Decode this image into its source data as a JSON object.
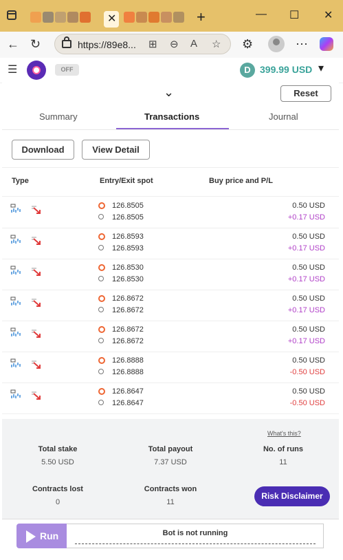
{
  "browser": {
    "url": "https://89e8...",
    "new_tab": "+"
  },
  "app": {
    "toggle": "OFF",
    "balance": "399.99 USD",
    "currency_icon": "D"
  },
  "panel": {
    "reset_label": "Reset",
    "tabs": [
      {
        "label": "Summary"
      },
      {
        "label": "Transactions"
      },
      {
        "label": "Journal"
      }
    ],
    "download_label": "Download",
    "view_detail_label": "View Detail",
    "columns": [
      "Type",
      "Entry/Exit spot",
      "Buy price and P/L"
    ]
  },
  "transactions": [
    {
      "entry": "126.8505",
      "exit": "126.8505",
      "price": "0.50 USD",
      "pl": "+0.17 USD"
    },
    {
      "entry": "126.8593",
      "exit": "126.8593",
      "price": "0.50 USD",
      "pl": "+0.17 USD"
    },
    {
      "entry": "126.8530",
      "exit": "126.8530",
      "price": "0.50 USD",
      "pl": "+0.17 USD"
    },
    {
      "entry": "126.8672",
      "exit": "126.8672",
      "price": "0.50 USD",
      "pl": "+0.17 USD"
    },
    {
      "entry": "126.8672",
      "exit": "126.8672",
      "price": "0.50 USD",
      "pl": "+0.17 USD"
    },
    {
      "entry": "126.8888",
      "exit": "126.8888",
      "price": "0.50 USD",
      "pl": "-0.50 USD"
    },
    {
      "entry": "126.8647",
      "exit": "126.8647",
      "price": "0.50 USD",
      "pl": "-0.50 USD"
    }
  ],
  "summary": {
    "whats_this": "What's this?",
    "total_stake_label": "Total stake",
    "total_stake": "5.50 USD",
    "total_payout_label": "Total payout",
    "total_payout": "7.37 USD",
    "runs_label": "No. of runs",
    "runs": "11",
    "lost_label": "Contracts lost",
    "lost": "0",
    "won_label": "Contracts won",
    "won": "11"
  },
  "risk_disclaimer": "Risk Disclaimer",
  "run": {
    "label": "Run",
    "status": "Bot is not running"
  },
  "colors": {
    "accent": "#4a2db3",
    "profit": "#b040c8",
    "loss": "#e04040",
    "balance": "#3aa39a"
  }
}
